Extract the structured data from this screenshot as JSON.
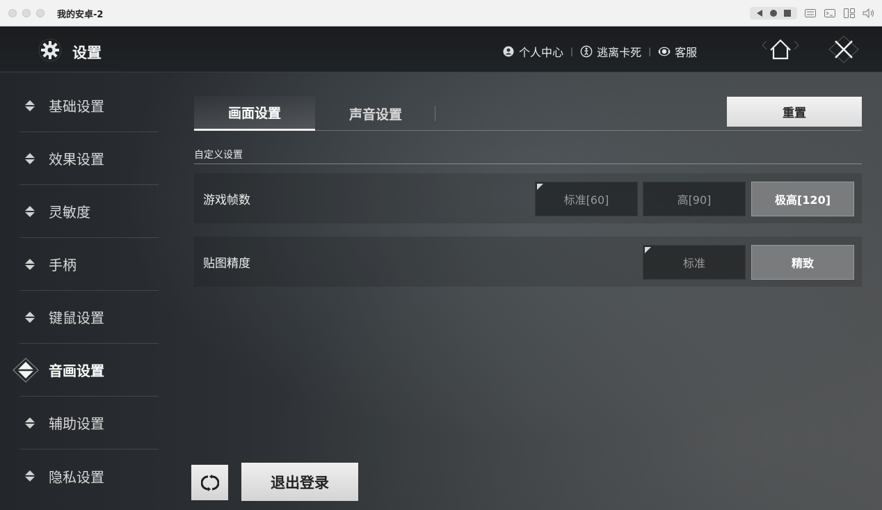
{
  "window": {
    "title": "我的安卓-2"
  },
  "header": {
    "title": "设置",
    "links": [
      {
        "label": "个人中心",
        "icon": "user-icon"
      },
      {
        "label": "逃离卡死",
        "icon": "escape-icon"
      },
      {
        "label": "客服",
        "icon": "headset-icon"
      }
    ]
  },
  "sidebar": {
    "items": [
      {
        "label": "基础设置"
      },
      {
        "label": "效果设置"
      },
      {
        "label": "灵敏度"
      },
      {
        "label": "手柄"
      },
      {
        "label": "键鼠设置"
      },
      {
        "label": "音画设置",
        "active": true
      },
      {
        "label": "辅助设置"
      },
      {
        "label": "隐私设置"
      }
    ]
  },
  "tabs": [
    {
      "label": "画面设置",
      "active": true
    },
    {
      "label": "声音设置",
      "active": false
    }
  ],
  "reset_label": "重置",
  "section_title": "自定义设置",
  "settings": [
    {
      "label": "游戏帧数",
      "options": [
        {
          "label": "标准[60]",
          "selected": false
        },
        {
          "label": "高[90]",
          "selected": false
        },
        {
          "label": "极高[120]",
          "selected": true
        }
      ]
    },
    {
      "label": "贴图精度",
      "options": [
        {
          "label": "标准",
          "selected": false
        },
        {
          "label": "精致",
          "selected": true
        }
      ]
    }
  ],
  "logout_label": "退出登录",
  "colors": {
    "accent": "#ffffff",
    "selected_option": "#7a7b7c",
    "panel": "#2b2f33"
  }
}
